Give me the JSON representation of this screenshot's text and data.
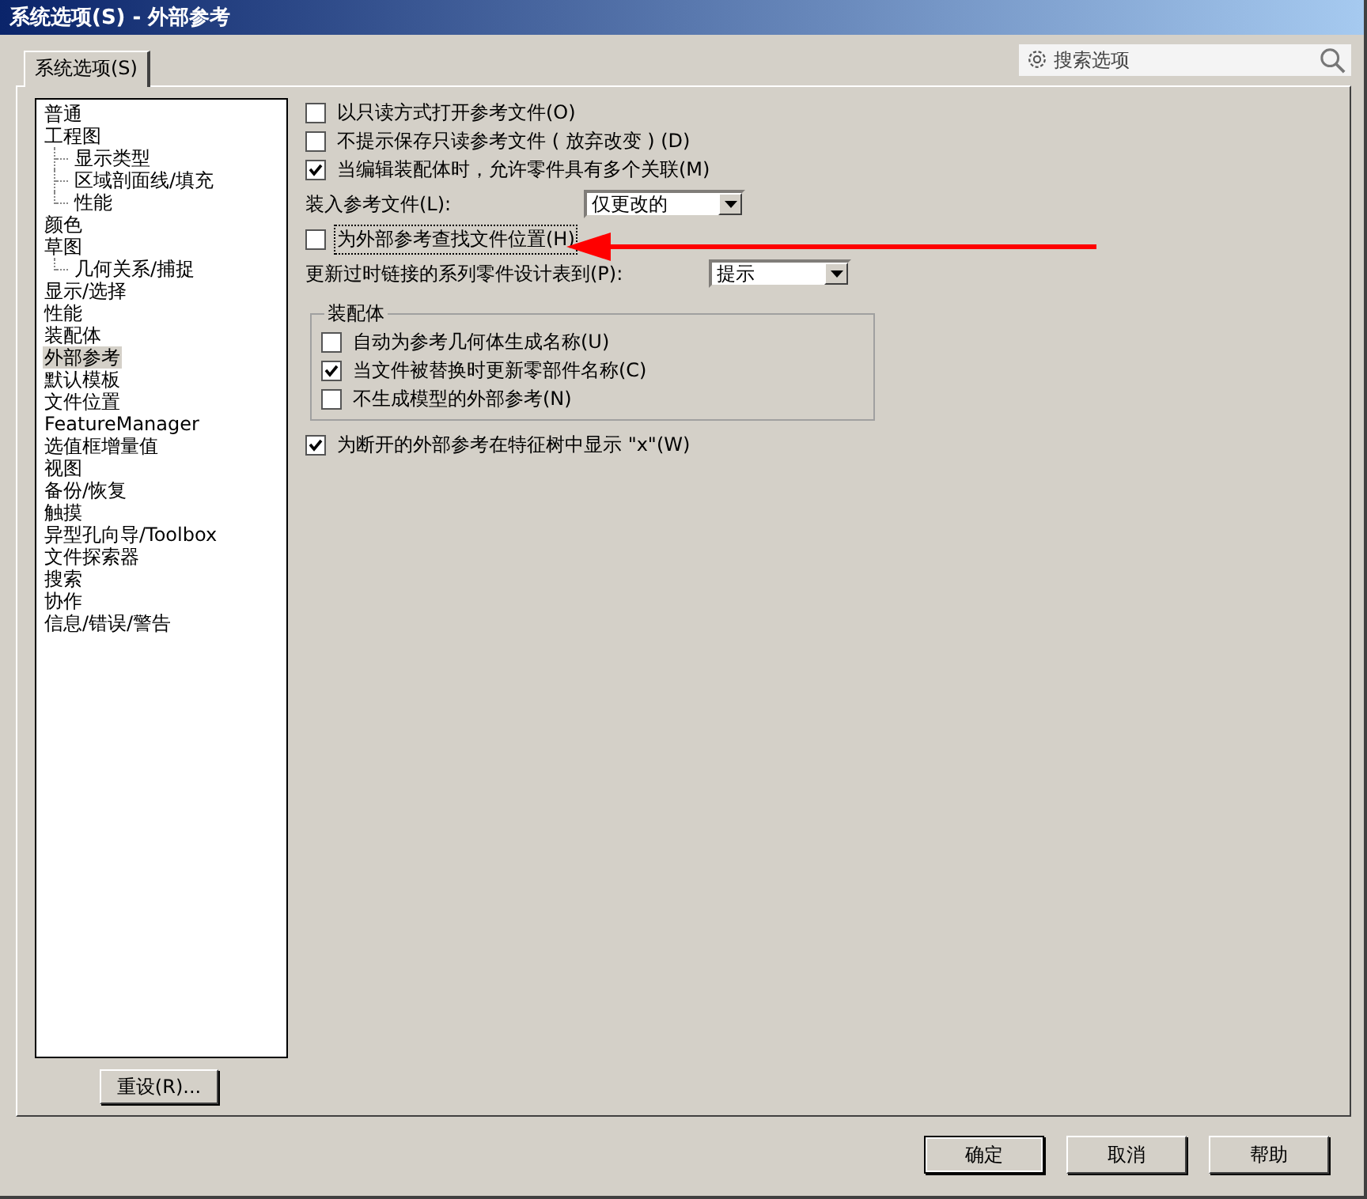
{
  "window": {
    "title": "系统选项(S) - 外部参考"
  },
  "search": {
    "placeholder": "搜索选项"
  },
  "tabs": [
    {
      "label": "系统选项(S)",
      "selected": true
    }
  ],
  "tree": [
    {
      "label": "普通",
      "selected": false
    },
    {
      "label": "工程图",
      "selected": false,
      "children": [
        {
          "label": "显示类型",
          "selected": false
        },
        {
          "label": "区域剖面线/填充",
          "selected": false
        },
        {
          "label": "性能",
          "selected": false
        }
      ]
    },
    {
      "label": "颜色",
      "selected": false
    },
    {
      "label": "草图",
      "selected": false,
      "children": [
        {
          "label": "几何关系/捕捉",
          "selected": false
        }
      ]
    },
    {
      "label": "显示/选择",
      "selected": false
    },
    {
      "label": "性能",
      "selected": false
    },
    {
      "label": "装配体",
      "selected": false
    },
    {
      "label": "外部参考",
      "selected": true
    },
    {
      "label": "默认模板",
      "selected": false
    },
    {
      "label": "文件位置",
      "selected": false
    },
    {
      "label": "FeatureManager",
      "selected": false
    },
    {
      "label": "选值框增量值",
      "selected": false
    },
    {
      "label": "视图",
      "selected": false
    },
    {
      "label": "备份/恢复",
      "selected": false
    },
    {
      "label": "触摸",
      "selected": false
    },
    {
      "label": "异型孔向导/Toolbox",
      "selected": false
    },
    {
      "label": "文件探索器",
      "selected": false
    },
    {
      "label": "搜索",
      "selected": false
    },
    {
      "label": "协作",
      "selected": false
    },
    {
      "label": "信息/错误/警告",
      "selected": false
    }
  ],
  "options": [
    {
      "kind": "checkbox",
      "label": "以只读方式打开参考文件(O)",
      "checked": false,
      "focused": false
    },
    {
      "kind": "checkbox",
      "label": "不提示保存只读参考文件 ( 放弃改变 ) (D)",
      "checked": false,
      "focused": false
    },
    {
      "kind": "checkbox",
      "label": "当编辑装配体时，允许零件具有多个关联(M)",
      "checked": true,
      "focused": false
    },
    {
      "kind": "dropdown",
      "label": "装入参考文件(L):",
      "value": "仅更改的"
    },
    {
      "kind": "checkbox",
      "label": "为外部参考查找文件位置(H)",
      "checked": false,
      "focused": true
    },
    {
      "kind": "dropdown",
      "label": "更新过时链接的系列零件设计表到(P):",
      "value": "提示"
    },
    {
      "kind": "group",
      "title": "装配体",
      "items": [
        {
          "label": "自动为参考几何体生成名称(U)",
          "checked": false
        },
        {
          "label": "当文件被替换时更新零部件名称(C)",
          "checked": true
        },
        {
          "label": "不生成模型的外部参考(N)",
          "checked": false
        }
      ]
    },
    {
      "kind": "checkbox",
      "label": "为断开的外部参考在特征树中显示 \"x\"(W)",
      "checked": true,
      "focused": false
    }
  ],
  "reset_button": "重设(R)...",
  "buttons": [
    {
      "label": "确定",
      "default": true
    },
    {
      "label": "取消",
      "default": false
    },
    {
      "label": "帮助",
      "default": false
    }
  ]
}
